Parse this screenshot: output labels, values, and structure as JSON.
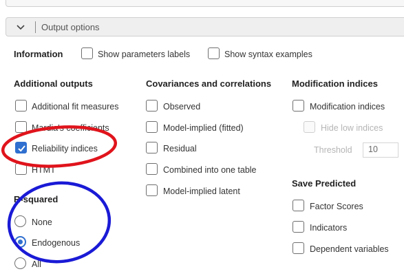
{
  "section": {
    "title": "Output options",
    "chevron_icon": "chevron-down-icon"
  },
  "information": {
    "heading": "Information",
    "show_parameters_labels": {
      "label": "Show parameters labels",
      "checked": false
    },
    "show_syntax_examples": {
      "label": "Show syntax examples",
      "checked": false
    }
  },
  "additional_outputs": {
    "heading": "Additional outputs",
    "items": [
      {
        "label": "Additional fit measures",
        "checked": false
      },
      {
        "label": "Mardia's coefficients",
        "checked": false
      },
      {
        "label": "Reliability indices",
        "checked": true
      },
      {
        "label": "HTMT",
        "checked": false
      }
    ]
  },
  "covariances": {
    "heading": "Covariances and correlations",
    "items": [
      {
        "label": "Observed",
        "checked": false
      },
      {
        "label": "Model-implied (fitted)",
        "checked": false
      },
      {
        "label": "Residual",
        "checked": false
      },
      {
        "label": "Combined into one table",
        "checked": false
      },
      {
        "label": "Model-implied latent",
        "checked": false
      }
    ]
  },
  "modification_indices": {
    "heading": "Modification indices",
    "checkbox": {
      "label": "Modification indices",
      "checked": false
    },
    "hide_low": {
      "label": "Hide low indices",
      "checked": false,
      "disabled": true
    },
    "threshold": {
      "label": "Threshold",
      "value": "10"
    }
  },
  "r_squared": {
    "heading": "R-squared",
    "options": [
      "None",
      "Endogenous",
      "All"
    ],
    "selected": "Endogenous"
  },
  "save_predicted": {
    "heading": "Save Predicted",
    "items": [
      {
        "label": "Factor Scores",
        "checked": false
      },
      {
        "label": "Indicators",
        "checked": false
      },
      {
        "label": "Dependent variables",
        "checked": false
      }
    ]
  },
  "annotations": {
    "red_ellipse_color": "#e0141c",
    "blue_ellipse_color": "#1a1ad6",
    "checked_color": "#2f6fcf"
  }
}
